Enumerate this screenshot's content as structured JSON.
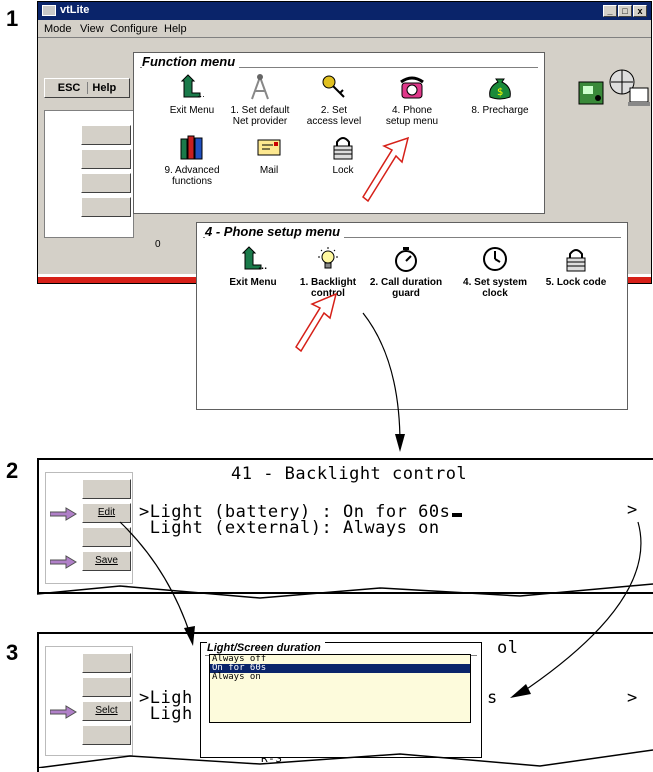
{
  "steps": [
    "1",
    "2",
    "3"
  ],
  "window": {
    "title": "vtLite",
    "controls": [
      "_",
      "□",
      "x"
    ],
    "menu": [
      "Mode",
      "View",
      "Configure",
      "Help"
    ],
    "buttons": {
      "esc": "ESC",
      "help": "Help"
    },
    "status_value": "0"
  },
  "function_menu": {
    "title": "Function menu",
    "items": [
      {
        "label": "Exit Menu",
        "icon": "exit-arrow-icon"
      },
      {
        "label": "1. Set default Net provider",
        "icon": "antenna-icon"
      },
      {
        "label": "2. Set access level",
        "icon": "keys-icon"
      },
      {
        "label": "4. Phone setup menu",
        "icon": "telephone-icon"
      },
      {
        "label": "8. Precharge",
        "icon": "money-bag-icon"
      },
      {
        "label": "9. Advanced functions",
        "icon": "books-icon"
      },
      {
        "label": "Mail",
        "icon": "envelope-icon"
      },
      {
        "label": "Lock",
        "icon": "padlock-icon"
      }
    ]
  },
  "phone_setup_menu": {
    "title": "4 - Phone setup menu",
    "items": [
      {
        "label": "Exit Menu",
        "icon": "exit-arrow-icon"
      },
      {
        "label": "1. Backlight control",
        "icon": "lightbulb-icon"
      },
      {
        "label": "2. Call duration guard",
        "icon": "stopwatch-icon"
      },
      {
        "label": "4. Set system clock",
        "icon": "clock-icon"
      },
      {
        "label": "5. Lock code",
        "icon": "padlock-icon"
      }
    ]
  },
  "backlight_screen": {
    "title": "41 - Backlight control",
    "line1": ">Light (battery) : On for 60s",
    "line2": " Light (external): Always on",
    "right_arrow": ">",
    "buttons": {
      "edit": "Edit",
      "save": "Save"
    }
  },
  "duration_screen": {
    "partial_title": "ol",
    "partial_line1": ">Ligh",
    "partial_line2": " Ligh",
    "partial_value": "s",
    "right_arrow": ">",
    "buttons": {
      "select": "Selct"
    },
    "dropdown": {
      "title": "Light/Screen duration",
      "options": [
        "Always off",
        "On for 60s",
        "Always on"
      ],
      "selected": "On for 60s"
    },
    "bottom_fragment": "R-S"
  },
  "colors": {
    "titlebar": "#0a246a",
    "accent_red": "#d62018",
    "pointer_arrow": "#b080c8",
    "dropdown_bg": "#fdfbdc"
  }
}
